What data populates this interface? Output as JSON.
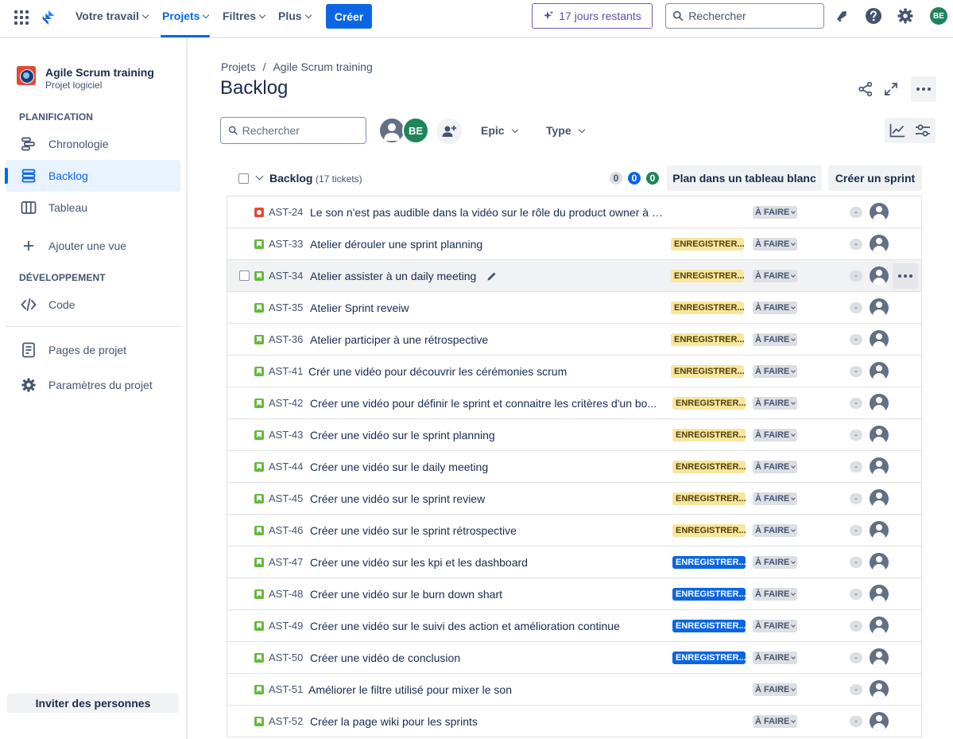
{
  "topnav": {
    "links": [
      {
        "label": "Votre travail"
      },
      {
        "label": "Projets"
      },
      {
        "label": "Filtres"
      },
      {
        "label": "Plus"
      }
    ],
    "create_label": "Créer",
    "trial_label": "17 jours restants",
    "search_placeholder": "Rechercher",
    "avatar_initials": "BE",
    "accent_color": "#0c66e4"
  },
  "sidebar": {
    "project_name": "Agile Scrum training",
    "project_type": "Projet logiciel",
    "planning_label": "PLANIFICATION",
    "items": [
      {
        "label": "Chronologie",
        "icon": "timeline-icon"
      },
      {
        "label": "Backlog",
        "icon": "backlog-icon"
      },
      {
        "label": "Tableau",
        "icon": "board-icon"
      },
      {
        "label": "Ajouter une vue",
        "icon": "plus-icon"
      }
    ],
    "dev_label": "DÉVELOPPEMENT",
    "code_label": "Code",
    "pages_label": "Pages de projet",
    "settings_label": "Paramètres du projet",
    "invite_label": "Inviter des personnes"
  },
  "main": {
    "breadcrumb": [
      "Projets",
      "/",
      "Agile Scrum training"
    ],
    "title": "Backlog",
    "search_placeholder": "Rechercher",
    "avatar_initials": "BE",
    "epic_filter": "Epic",
    "type_filter": "Type"
  },
  "backlog": {
    "title": "Backlog",
    "count": "(17 tickets)",
    "status_counts": [
      "0",
      "0",
      "0"
    ],
    "plan_button": "Plan dans un tableau blanc",
    "create_sprint_button": "Créer un sprint",
    "issues": [
      {
        "key": "AST-24",
        "summary": "Le son n'est pas audible dans la vidéo sur le rôle du product owner à l'...",
        "type": "bug",
        "epic": "",
        "epic_color": "",
        "status": "À FAIRE",
        "estimate": "-"
      },
      {
        "key": "AST-33",
        "summary": "Atelier dérouler une sprint planning",
        "type": "story",
        "epic": "ENREGISTRER...",
        "epic_color": "yellow",
        "status": "À FAIRE",
        "estimate": "-"
      },
      {
        "key": "AST-34",
        "summary": "Atelier assister à un daily meeting",
        "type": "story",
        "epic": "ENREGISTRER...",
        "epic_color": "yellow",
        "status": "À FAIRE",
        "estimate": "-"
      },
      {
        "key": "AST-35",
        "summary": "Atelier Sprint reveiw",
        "type": "story",
        "epic": "ENREGISTRER...",
        "epic_color": "yellow",
        "status": "À FAIRE",
        "estimate": "-"
      },
      {
        "key": "AST-36",
        "summary": "Atelier participer à une rétrospective",
        "type": "story",
        "epic": "ENREGISTRER...",
        "epic_color": "yellow",
        "status": "À FAIRE",
        "estimate": "-"
      },
      {
        "key": "AST-41",
        "summary": "Crér une vidéo pour découvrir les cérémonies scrum",
        "type": "story",
        "epic": "ENREGISTRER...",
        "epic_color": "yellow",
        "status": "À FAIRE",
        "estimate": "-"
      },
      {
        "key": "AST-42",
        "summary": "Créer une vidéo pour définir le sprint et connaitre les critères d'un bo...",
        "type": "story",
        "epic": "ENREGISTRER...",
        "epic_color": "yellow",
        "status": "À FAIRE",
        "estimate": "-"
      },
      {
        "key": "AST-43",
        "summary": "Créer une vidéo sur le sprint planning",
        "type": "story",
        "epic": "ENREGISTRER...",
        "epic_color": "yellow",
        "status": "À FAIRE",
        "estimate": "-"
      },
      {
        "key": "AST-44",
        "summary": "Créer une vidéo sur le daily meeting",
        "type": "story",
        "epic": "ENREGISTRER...",
        "epic_color": "yellow",
        "status": "À FAIRE",
        "estimate": "-"
      },
      {
        "key": "AST-45",
        "summary": "Créer une vidéo sur le sprint review",
        "type": "story",
        "epic": "ENREGISTRER...",
        "epic_color": "yellow",
        "status": "À FAIRE",
        "estimate": "-"
      },
      {
        "key": "AST-46",
        "summary": "Créer une vidéo sur le sprint rétrospective",
        "type": "story",
        "epic": "ENREGISTRER...",
        "epic_color": "yellow",
        "status": "À FAIRE",
        "estimate": "-"
      },
      {
        "key": "AST-47",
        "summary": "Créer une vidéo sur les kpi et les dashboard",
        "type": "story",
        "epic": "ENREGISTRER...",
        "epic_color": "blue",
        "status": "À FAIRE",
        "estimate": "-"
      },
      {
        "key": "AST-48",
        "summary": "Créer une vidéo sur le burn down shart",
        "type": "story",
        "epic": "ENREGISTRER...",
        "epic_color": "blue",
        "status": "À FAIRE",
        "estimate": "-"
      },
      {
        "key": "AST-49",
        "summary": "Créer une vidéo sur le suivi des action et amélioration continue",
        "type": "story",
        "epic": "ENREGISTRER...",
        "epic_color": "blue",
        "status": "À FAIRE",
        "estimate": "-"
      },
      {
        "key": "AST-50",
        "summary": "Créer une vidéo de conclusion",
        "type": "story",
        "epic": "ENREGISTRER...",
        "epic_color": "blue",
        "status": "À FAIRE",
        "estimate": "-"
      },
      {
        "key": "AST-51",
        "summary": "Améliorer le filtre utilisé pour mixer le son",
        "type": "story",
        "epic": "",
        "epic_color": "",
        "status": "À FAIRE",
        "estimate": "-"
      },
      {
        "key": "AST-52",
        "summary": "Créer la page wiki pour les sprints",
        "type": "story",
        "epic": "",
        "epic_color": "",
        "status": "À FAIRE",
        "estimate": "-"
      }
    ]
  }
}
